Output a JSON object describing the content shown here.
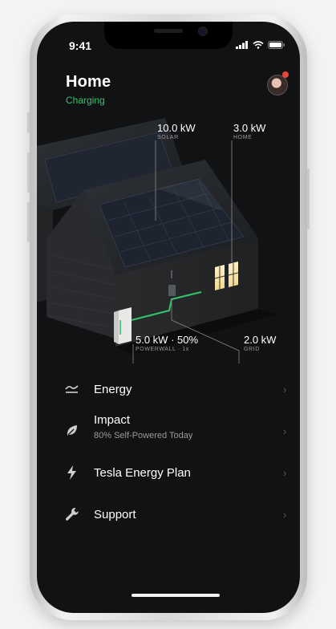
{
  "status_bar": {
    "time": "9:41"
  },
  "header": {
    "title": "Home",
    "status": "Charging"
  },
  "metrics": {
    "solar": {
      "value": "10.0 kW",
      "label": "SOLAR"
    },
    "home": {
      "value": "3.0 kW",
      "label": "HOME"
    },
    "powerwall": {
      "value": "5.0 kW · 50%",
      "label": "POWERWALL · 1x"
    },
    "grid": {
      "value": "2.0 kW",
      "label": "GRID"
    }
  },
  "menu": {
    "items": [
      {
        "label": "Energy",
        "icon": "energy-chart-icon"
      },
      {
        "label": "Impact",
        "sub": "80% Self-Powered Today",
        "icon": "leaf-icon"
      },
      {
        "label": "Tesla Energy Plan",
        "icon": "bolt-icon"
      },
      {
        "label": "Support",
        "icon": "wrench-icon"
      }
    ],
    "chevron": "›"
  },
  "colors": {
    "accent": "#36c36a",
    "background": "#111213",
    "notification": "#e6453a"
  }
}
